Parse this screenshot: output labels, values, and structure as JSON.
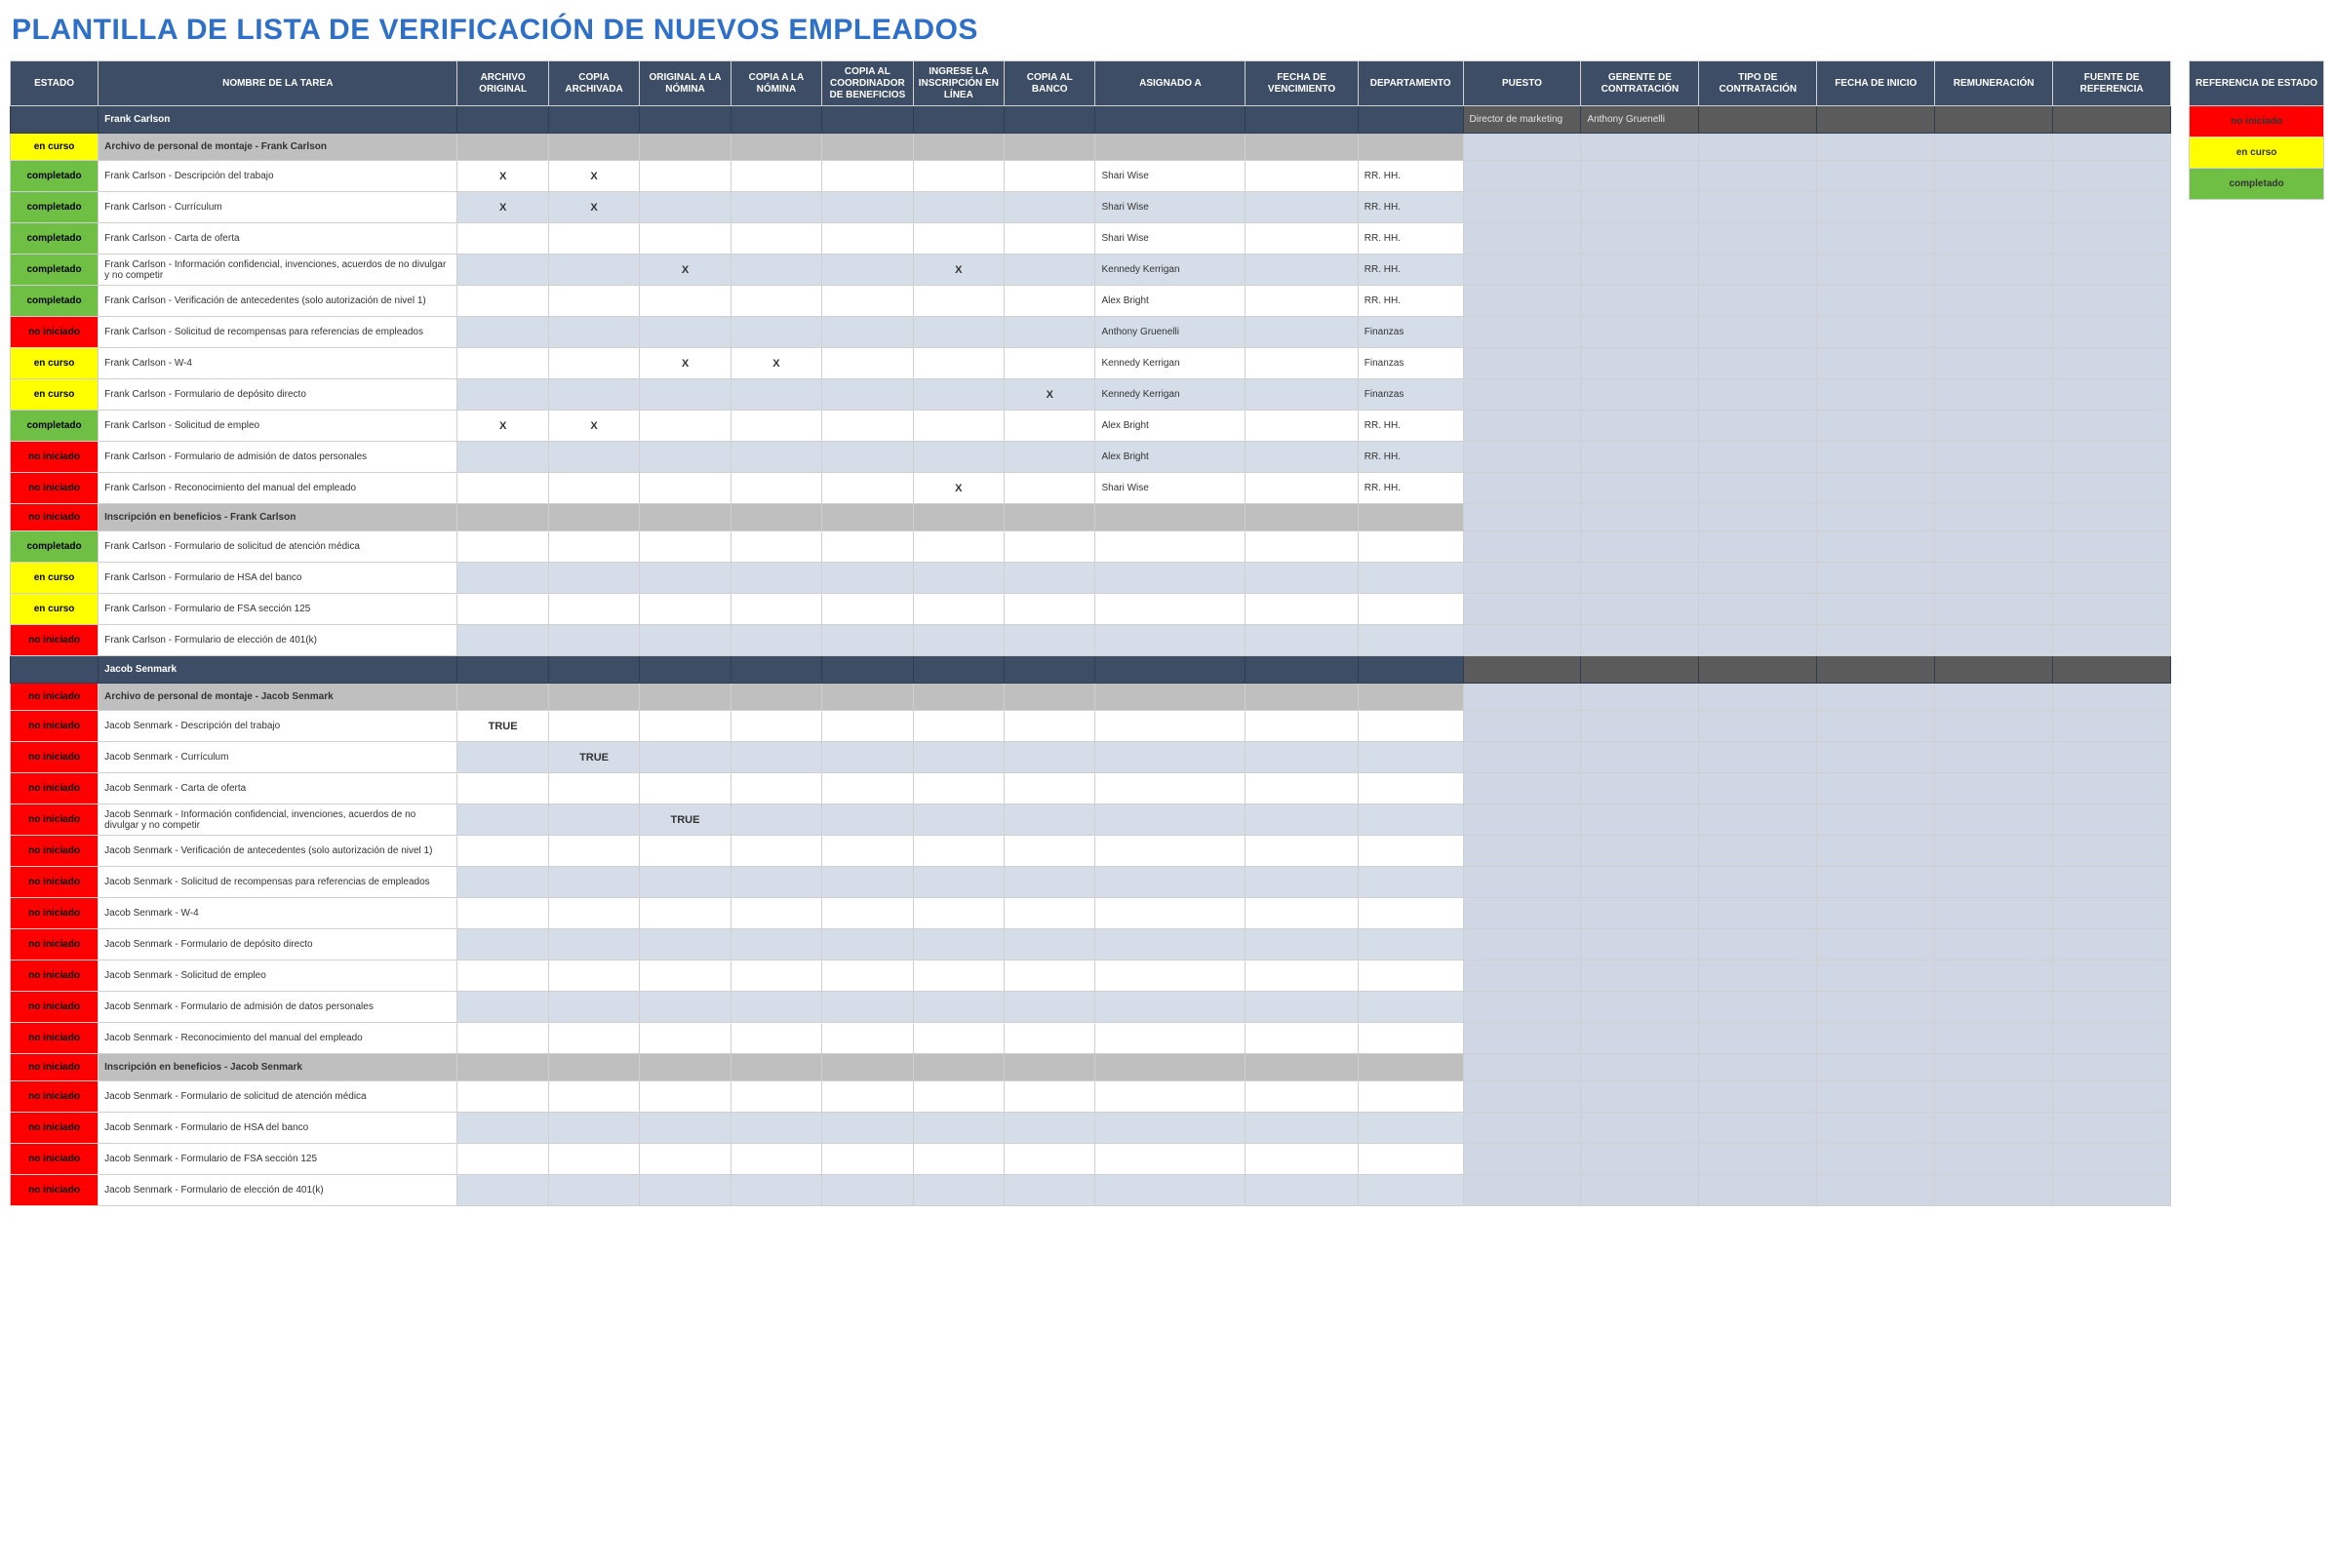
{
  "title": "PLANTILLA DE LISTA DE VERIFICACIÓN DE NUEVOS EMPLEADOS",
  "headers": [
    "ESTADO",
    "NOMBRE DE LA TAREA",
    "ARCHIVO ORIGINAL",
    "COPIA ARCHIVADA",
    "ORIGINAL A LA NÓMINA",
    "COPIA A LA NÓMINA",
    "COPIA AL COORDINADOR DE BENEFICIOS",
    "INGRESE LA INSCRIPCIÓN EN LÍNEA",
    "COPIA AL BANCO",
    "ASIGNADO A",
    "FECHA DE VENCIMIENTO",
    "DEPARTAMENTO",
    "PUESTO",
    "GERENTE DE CONTRATACIÓN",
    "TIPO DE CONTRATACIÓN",
    "FECHA DE INICIO",
    "REMUNERACIÓN",
    "FUENTE DE REFERENCIA"
  ],
  "legend_header": "REFERENCIA DE ESTADO",
  "legend": [
    "no iniciado",
    "en curso",
    "completado"
  ],
  "rows": [
    {
      "kind": "person",
      "task": "Frank Carlson",
      "right": {
        "puesto": "Director de marketing",
        "gerente": "Anthony Gruenelli"
      }
    },
    {
      "kind": "section",
      "status": "en curso",
      "task": "Archivo de personal de montaje - Frank Carlson"
    },
    {
      "kind": "data",
      "alt": false,
      "status": "completado",
      "task": "Frank Carlson - Descripción del trabajo",
      "x": [
        "X",
        "X",
        "",
        "",
        "",
        "",
        ""
      ],
      "assigned": "Shari Wise",
      "dept": "RR. HH."
    },
    {
      "kind": "data",
      "alt": true,
      "status": "completado",
      "task": "Frank Carlson - Currículum",
      "x": [
        "X",
        "X",
        "",
        "",
        "",
        "",
        ""
      ],
      "assigned": "Shari Wise",
      "dept": "RR. HH."
    },
    {
      "kind": "data",
      "alt": false,
      "status": "completado",
      "task": "Frank Carlson - Carta de oferta",
      "x": [
        "",
        "",
        "",
        "",
        "",
        "",
        ""
      ],
      "assigned": "Shari Wise",
      "dept": "RR. HH."
    },
    {
      "kind": "data",
      "alt": true,
      "status": "completado",
      "task": "Frank Carlson - Información confidencial, invenciones, acuerdos de no divulgar y no competir",
      "x": [
        "",
        "",
        "X",
        "",
        "",
        "X",
        ""
      ],
      "assigned": "Kennedy Kerrigan",
      "dept": "RR. HH."
    },
    {
      "kind": "data",
      "alt": false,
      "status": "completado",
      "task": "Frank Carlson - Verificación de antecedentes (solo autorización de nivel 1)",
      "x": [
        "",
        "",
        "",
        "",
        "",
        "",
        ""
      ],
      "assigned": "Alex Bright",
      "dept": "RR. HH."
    },
    {
      "kind": "data",
      "alt": true,
      "status": "no iniciado",
      "task": "Frank Carlson - Solicitud de recompensas para referencias de empleados",
      "x": [
        "",
        "",
        "",
        "",
        "",
        "",
        ""
      ],
      "assigned": "Anthony Gruenelli",
      "dept": "Finanzas"
    },
    {
      "kind": "data",
      "alt": false,
      "status": "en curso",
      "task": "Frank Carlson - W-4",
      "x": [
        "",
        "",
        "X",
        "X",
        "",
        "",
        ""
      ],
      "assigned": "Kennedy Kerrigan",
      "dept": "Finanzas"
    },
    {
      "kind": "data",
      "alt": true,
      "status": "en curso",
      "task": "Frank Carlson - Formulario de depósito directo",
      "x": [
        "",
        "",
        "",
        "",
        "",
        "",
        "X"
      ],
      "assigned": "Kennedy Kerrigan",
      "dept": "Finanzas"
    },
    {
      "kind": "data",
      "alt": false,
      "status": "completado",
      "task": "Frank Carlson - Solicitud de empleo",
      "x": [
        "X",
        "X",
        "",
        "",
        "",
        "",
        ""
      ],
      "assigned": "Alex Bright",
      "dept": "RR. HH."
    },
    {
      "kind": "data",
      "alt": true,
      "status": "no iniciado",
      "task": "Frank Carlson - Formulario de admisión de datos personales",
      "x": [
        "",
        "",
        "",
        "",
        "",
        "",
        ""
      ],
      "assigned": "Alex Bright",
      "dept": "RR. HH."
    },
    {
      "kind": "data",
      "alt": false,
      "status": "no iniciado",
      "task": "Frank Carlson - Reconocimiento del manual del empleado",
      "x": [
        "",
        "",
        "",
        "",
        "",
        "X",
        ""
      ],
      "assigned": "Shari Wise",
      "dept": "RR. HH."
    },
    {
      "kind": "section",
      "status": "no iniciado",
      "task": "Inscripción en beneficios - Frank Carlson"
    },
    {
      "kind": "data",
      "alt": false,
      "status": "completado",
      "task": "Frank Carlson - Formulario de solicitud de atención médica",
      "x": [
        "",
        "",
        "",
        "",
        "",
        "",
        ""
      ],
      "assigned": "",
      "dept": ""
    },
    {
      "kind": "data",
      "alt": true,
      "status": "en curso",
      "task": "Frank Carlson - Formulario de HSA del banco",
      "x": [
        "",
        "",
        "",
        "",
        "",
        "",
        ""
      ],
      "assigned": "",
      "dept": ""
    },
    {
      "kind": "data",
      "alt": false,
      "status": "en curso",
      "task": "Frank Carlson - Formulario de FSA sección 125",
      "x": [
        "",
        "",
        "",
        "",
        "",
        "",
        ""
      ],
      "assigned": "",
      "dept": ""
    },
    {
      "kind": "data",
      "alt": true,
      "status": "no iniciado",
      "task": "Frank Carlson - Formulario de elección de 401(k)",
      "x": [
        "",
        "",
        "",
        "",
        "",
        "",
        ""
      ],
      "assigned": "",
      "dept": ""
    },
    {
      "kind": "person",
      "task": "Jacob Senmark",
      "right": {}
    },
    {
      "kind": "section",
      "status": "no iniciado",
      "task": "Archivo de personal de montaje - Jacob Senmark"
    },
    {
      "kind": "data",
      "alt": false,
      "status": "no iniciado",
      "task": "Jacob Senmark - Descripción del trabajo",
      "x": [
        "TRUE",
        "",
        "",
        "",
        "",
        "",
        ""
      ],
      "assigned": "",
      "dept": ""
    },
    {
      "kind": "data",
      "alt": true,
      "status": "no iniciado",
      "task": "Jacob Senmark - Currículum",
      "x": [
        "",
        "TRUE",
        "",
        "",
        "",
        "",
        ""
      ],
      "assigned": "",
      "dept": ""
    },
    {
      "kind": "data",
      "alt": false,
      "status": "no iniciado",
      "task": "Jacob Senmark - Carta de oferta",
      "x": [
        "",
        "",
        "",
        "",
        "",
        "",
        ""
      ],
      "assigned": "",
      "dept": ""
    },
    {
      "kind": "data",
      "alt": true,
      "status": "no iniciado",
      "task": "Jacob Senmark - Información confidencial, invenciones, acuerdos de no divulgar y no competir",
      "x": [
        "",
        "",
        "TRUE",
        "",
        "",
        "",
        ""
      ],
      "assigned": "",
      "dept": ""
    },
    {
      "kind": "data",
      "alt": false,
      "status": "no iniciado",
      "task": "Jacob Senmark - Verificación de antecedentes (solo autorización de nivel 1)",
      "x": [
        "",
        "",
        "",
        "",
        "",
        "",
        ""
      ],
      "assigned": "",
      "dept": ""
    },
    {
      "kind": "data",
      "alt": true,
      "status": "no iniciado",
      "task": "Jacob Senmark - Solicitud de recompensas para referencias de empleados",
      "x": [
        "",
        "",
        "",
        "",
        "",
        "",
        ""
      ],
      "assigned": "",
      "dept": ""
    },
    {
      "kind": "data",
      "alt": false,
      "status": "no iniciado",
      "task": "Jacob Senmark - W-4",
      "x": [
        "",
        "",
        "",
        "",
        "",
        "",
        ""
      ],
      "assigned": "",
      "dept": ""
    },
    {
      "kind": "data",
      "alt": true,
      "status": "no iniciado",
      "task": "Jacob Senmark - Formulario de depósito directo",
      "x": [
        "",
        "",
        "",
        "",
        "",
        "",
        ""
      ],
      "assigned": "",
      "dept": ""
    },
    {
      "kind": "data",
      "alt": false,
      "status": "no iniciado",
      "task": "Jacob Senmark - Solicitud de empleo",
      "x": [
        "",
        "",
        "",
        "",
        "",
        "",
        ""
      ],
      "assigned": "",
      "dept": ""
    },
    {
      "kind": "data",
      "alt": true,
      "status": "no iniciado",
      "task": "Jacob Senmark - Formulario de admisión de datos personales",
      "x": [
        "",
        "",
        "",
        "",
        "",
        "",
        ""
      ],
      "assigned": "",
      "dept": ""
    },
    {
      "kind": "data",
      "alt": false,
      "status": "no iniciado",
      "task": "Jacob Senmark - Reconocimiento del manual del empleado",
      "x": [
        "",
        "",
        "",
        "",
        "",
        "",
        ""
      ],
      "assigned": "",
      "dept": ""
    },
    {
      "kind": "section",
      "status": "no iniciado",
      "task": "Inscripción en beneficios - Jacob Senmark"
    },
    {
      "kind": "data",
      "alt": false,
      "status": "no iniciado",
      "task": "Jacob Senmark - Formulario de solicitud de atención médica",
      "x": [
        "",
        "",
        "",
        "",
        "",
        "",
        ""
      ],
      "assigned": "",
      "dept": ""
    },
    {
      "kind": "data",
      "alt": true,
      "status": "no iniciado",
      "task": "Jacob Senmark - Formulario de HSA del banco",
      "x": [
        "",
        "",
        "",
        "",
        "",
        "",
        ""
      ],
      "assigned": "",
      "dept": ""
    },
    {
      "kind": "data",
      "alt": false,
      "status": "no iniciado",
      "task": "Jacob Senmark - Formulario de FSA sección 125",
      "x": [
        "",
        "",
        "",
        "",
        "",
        "",
        ""
      ],
      "assigned": "",
      "dept": ""
    },
    {
      "kind": "data",
      "alt": true,
      "status": "no iniciado",
      "task": "Jacob Senmark - Formulario de elección de 401(k)",
      "x": [
        "",
        "",
        "",
        "",
        "",
        "",
        ""
      ],
      "assigned": "",
      "dept": ""
    }
  ]
}
